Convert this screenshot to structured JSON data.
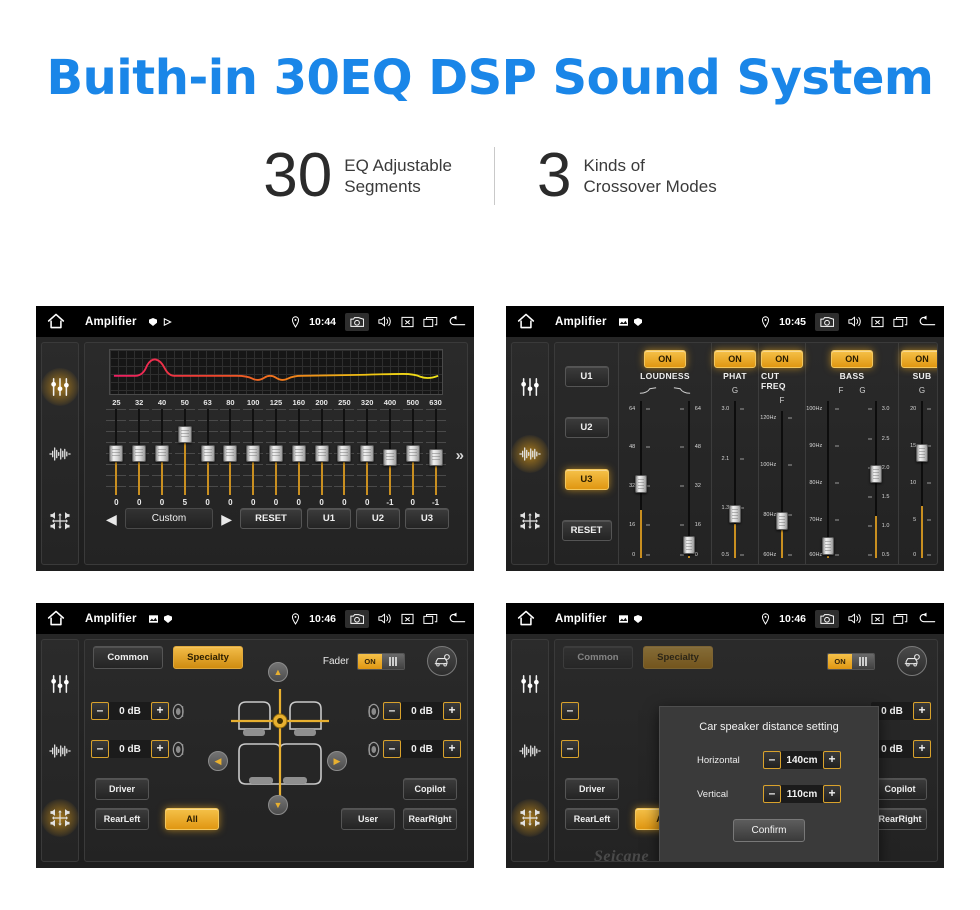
{
  "hero": {
    "title": "Buith-in 30EQ DSP Sound System",
    "stats": [
      {
        "number": "30",
        "line1": "EQ Adjustable",
        "line2": "Segments"
      },
      {
        "number": "3",
        "line1": "Kinds of",
        "line2": "Crossover Modes"
      }
    ]
  },
  "colors": {
    "accent_blue": "#1a86e8",
    "amber": "#e09712",
    "amber_light": "#f5c149",
    "screen_bg": "#1b1b1b"
  },
  "statusbar": {
    "title": "Amplifier",
    "times": [
      "10:44",
      "10:45",
      "10:46",
      "10:46"
    ],
    "icons": [
      "home-icon",
      "location-pin-icon",
      "camera-icon",
      "volume-icon",
      "close-box-icon",
      "recents-icon",
      "back-arrow-icon"
    ]
  },
  "sidebar": {
    "items": [
      {
        "name": "equalizer-icon",
        "label": "Equalizer"
      },
      {
        "name": "waveform-icon",
        "label": "Sound Effect"
      },
      {
        "name": "balance-icon",
        "label": "Balance"
      }
    ]
  },
  "panel_eq": {
    "frequencies": [
      "25",
      "32",
      "40",
      "50",
      "63",
      "80",
      "100",
      "125",
      "160",
      "200",
      "250",
      "320",
      "400",
      "500",
      "630"
    ],
    "values": [
      "0",
      "0",
      "0",
      "5",
      "0",
      "0",
      "0",
      "0",
      "0",
      "0",
      "0",
      "0",
      "-1",
      "0",
      "-1"
    ],
    "preset": "Custom",
    "prev_label": "◀",
    "next_label": "▶",
    "more_label": "»",
    "reset_label": "RESET",
    "user_buttons": [
      "U1",
      "U2",
      "U3"
    ]
  },
  "panel_dsp": {
    "user_buttons": [
      "U1",
      "U2",
      "U3"
    ],
    "active_user": "U3",
    "reset_label": "RESET",
    "groups": [
      {
        "label": "LOUDNESS",
        "state": "ON",
        "headers": [
          "curve-up-icon",
          "curve-down-icon"
        ],
        "sliders": [
          {
            "ticks_left": [
              "64",
              "48",
              "32",
              "16",
              "0"
            ],
            "ticks_right": [
              "64",
              "48",
              "32",
              "16",
              "0"
            ],
            "value": "32"
          },
          {
            "ticks_left": [],
            "ticks_right": [
              "64",
              "48",
              "32",
              "16",
              "0"
            ],
            "value": "0"
          }
        ]
      },
      {
        "label": "PHAT",
        "state": "ON",
        "headers": [
          "G"
        ],
        "sliders": [
          {
            "ticks_left": [
              "3.0",
              "2.1",
              "1.3",
              "0.5"
            ],
            "ticks_right": [],
            "value": "1.3"
          }
        ]
      },
      {
        "label": "CUT FREQ",
        "state": "ON",
        "headers": [
          "F"
        ],
        "sliders": [
          {
            "ticks_left": [
              "120Hz",
              "100Hz",
              "80Hz",
              "60Hz"
            ],
            "ticks_right": [],
            "value": "80Hz"
          }
        ]
      },
      {
        "label": "BASS",
        "state": "ON",
        "headers": [
          "F",
          "G"
        ],
        "sliders": [
          {
            "ticks_left": [
              "100Hz",
              "90Hz",
              "80Hz",
              "70Hz",
              "60Hz"
            ],
            "ticks_right": [],
            "value": "60Hz"
          },
          {
            "ticks_left": [],
            "ticks_right": [
              "3.0",
              "2.5",
              "2.0",
              "1.5",
              "1.0",
              "0.5"
            ],
            "value": "2.0"
          }
        ]
      },
      {
        "label": "SUB",
        "state": "ON",
        "headers": [
          "G"
        ],
        "sliders": [
          {
            "ticks_left": [
              "20",
              "15",
              "10",
              "5",
              "0"
            ],
            "ticks_right": [],
            "value": "15"
          }
        ]
      }
    ]
  },
  "panel_fader": {
    "tabs": [
      {
        "label": "Common",
        "selected": false
      },
      {
        "label": "Specialty",
        "selected": true
      }
    ],
    "fader_label": "Fader",
    "fader_state": "ON",
    "car_settings_icon": "car-settings-icon",
    "steppers": [
      {
        "position": "front-left",
        "value": "0 dB"
      },
      {
        "position": "rear-left",
        "value": "0 dB"
      },
      {
        "position": "front-right",
        "value": "0 dB"
      },
      {
        "position": "rear-right",
        "value": "0 dB"
      }
    ],
    "minus_label": "–",
    "plus_label": "+",
    "seat_buttons": [
      {
        "label": "Driver",
        "selected": false
      },
      {
        "label": "Copilot",
        "selected": false
      },
      {
        "label": "RearLeft",
        "selected": false
      },
      {
        "label": "All",
        "selected": true
      },
      {
        "label": "User",
        "selected": false
      },
      {
        "label": "RearRight",
        "selected": false
      }
    ],
    "dpad": [
      "up-arrow-icon",
      "down-arrow-icon",
      "left-arrow-icon",
      "right-arrow-icon"
    ]
  },
  "panel_dialog": {
    "title": "Car speaker distance setting",
    "rows": [
      {
        "label": "Horizontal",
        "value": "140cm"
      },
      {
        "label": "Vertical",
        "value": "110cm"
      }
    ],
    "confirm_label": "Confirm",
    "minus_label": "–",
    "plus_label": "+"
  },
  "watermark": "Seicane"
}
